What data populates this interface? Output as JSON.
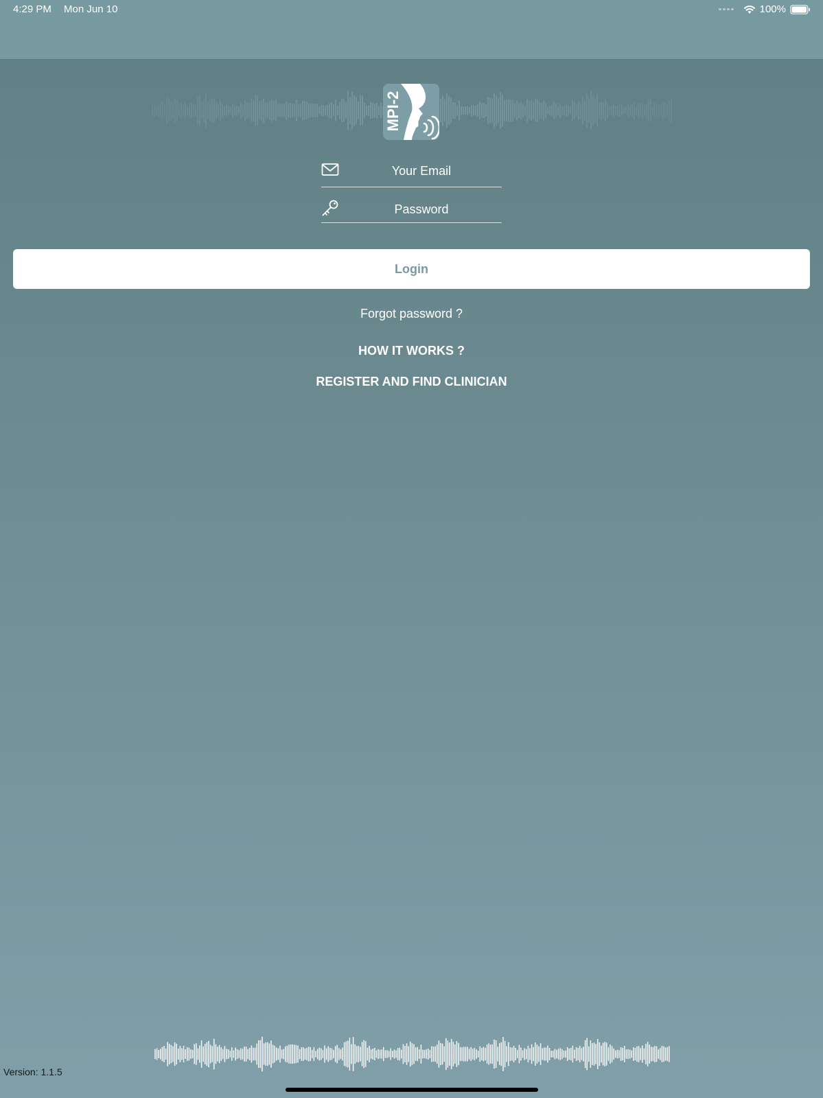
{
  "status_bar": {
    "time": "4:29 PM",
    "date": "Mon Jun 10",
    "battery": "100%",
    "icons": [
      "cellular-signal-icon",
      "wifi-icon",
      "battery-icon"
    ]
  },
  "brand": {
    "logo_text": "MPI-2"
  },
  "login_form": {
    "email_placeholder": "Your Email",
    "email_value": "",
    "password_placeholder": "Password",
    "password_value": "",
    "login_label": "Login"
  },
  "links": {
    "forgot_password": "Forgot password ?",
    "how_it_works": "HOW IT WORKS ?",
    "register": "REGISTER AND FIND CLINICIAN"
  },
  "footer": {
    "version": "Version: 1.1.5"
  },
  "colors": {
    "background_top": "#5f7f84",
    "background_bottom": "#819fa8",
    "header": "#779aa1",
    "login_text": "#7998a0",
    "white": "#ffffff"
  }
}
